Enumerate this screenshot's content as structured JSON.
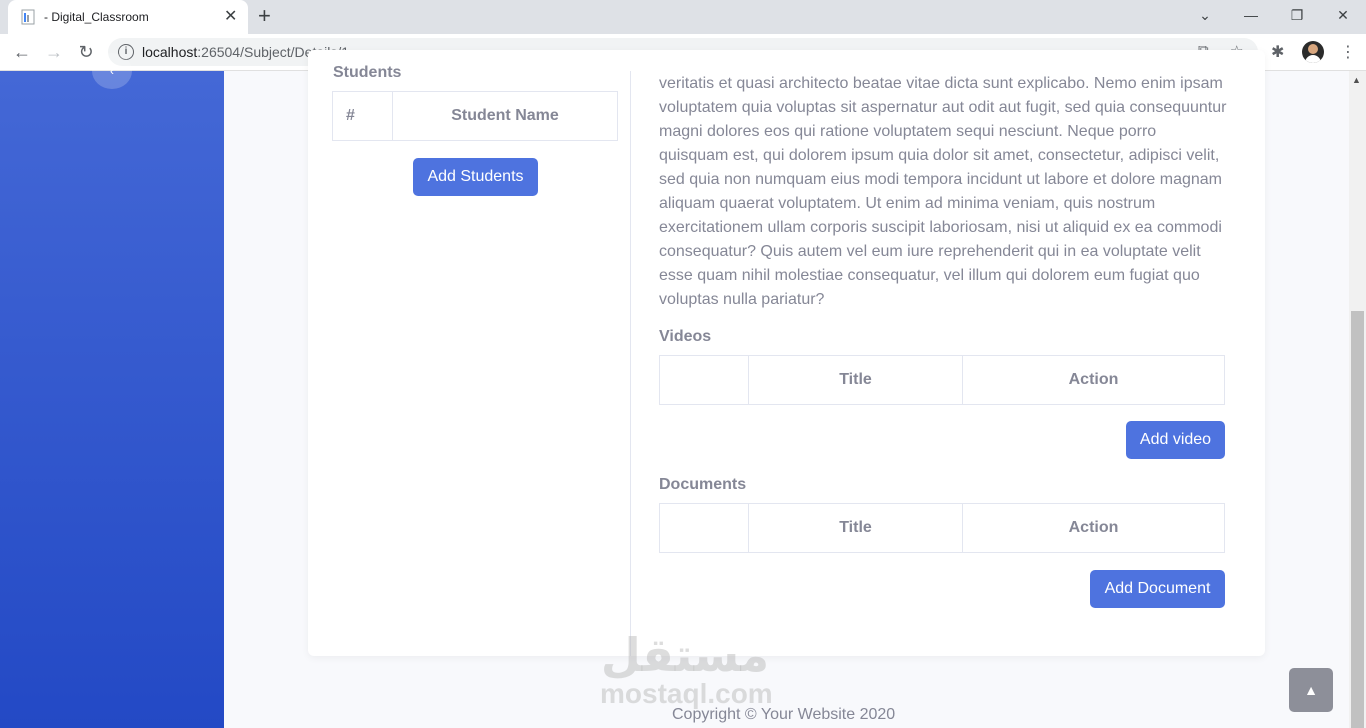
{
  "browser": {
    "tab_title": "- Digital_Classroom",
    "tab_close": "✕",
    "new_tab": "+",
    "url_host": "localhost",
    "url_path": ":26504/Subject/Details/1",
    "window_controls": [
      "⌄",
      "—",
      "❐",
      "✕"
    ],
    "icons": [
      "back-icon",
      "forward-icon",
      "reload-icon",
      "share-icon",
      "star-icon",
      "extensions-icon",
      "menu-icon"
    ]
  },
  "students": {
    "heading": "Students",
    "columns": [
      "#",
      "Student Name"
    ],
    "add_button": "Add Students"
  },
  "description": "veritatis et quasi architecto beatae vitae dicta sunt explicabo. Nemo enim ipsam voluptatem quia voluptas sit aspernatur aut odit aut fugit, sed quia consequuntur magni dolores eos qui ratione voluptatem sequi nesciunt. Neque porro quisquam est, qui dolorem ipsum quia dolor sit amet, consectetur, adipisci velit, sed quia non numquam eius modi tempora incidunt ut labore et dolore magnam aliquam quaerat voluptatem. Ut enim ad minima veniam, quis nostrum exercitationem ullam corporis suscipit laboriosam, nisi ut aliquid ex ea commodi consequatur? Quis autem vel eum iure reprehenderit qui in ea voluptate velit esse quam nihil molestiae consequatur, vel illum qui dolorem eum fugiat quo voluptas nulla pariatur?",
  "videos": {
    "heading": "Videos",
    "columns": [
      "",
      "Title",
      "Action"
    ],
    "add_button": "Add video"
  },
  "documents": {
    "heading": "Documents",
    "columns": [
      "",
      "Title",
      "Action"
    ],
    "add_button": "Add Document"
  },
  "footer": {
    "copyright": "Copyright © Your Website 2020",
    "watermark_ar": "مستقل",
    "watermark_en": "mostaql.com"
  },
  "colors": {
    "primary": "#4e73df",
    "sidebar_top": "#4468d6",
    "sidebar_bottom": "#2349c5",
    "text_muted": "#858796"
  }
}
